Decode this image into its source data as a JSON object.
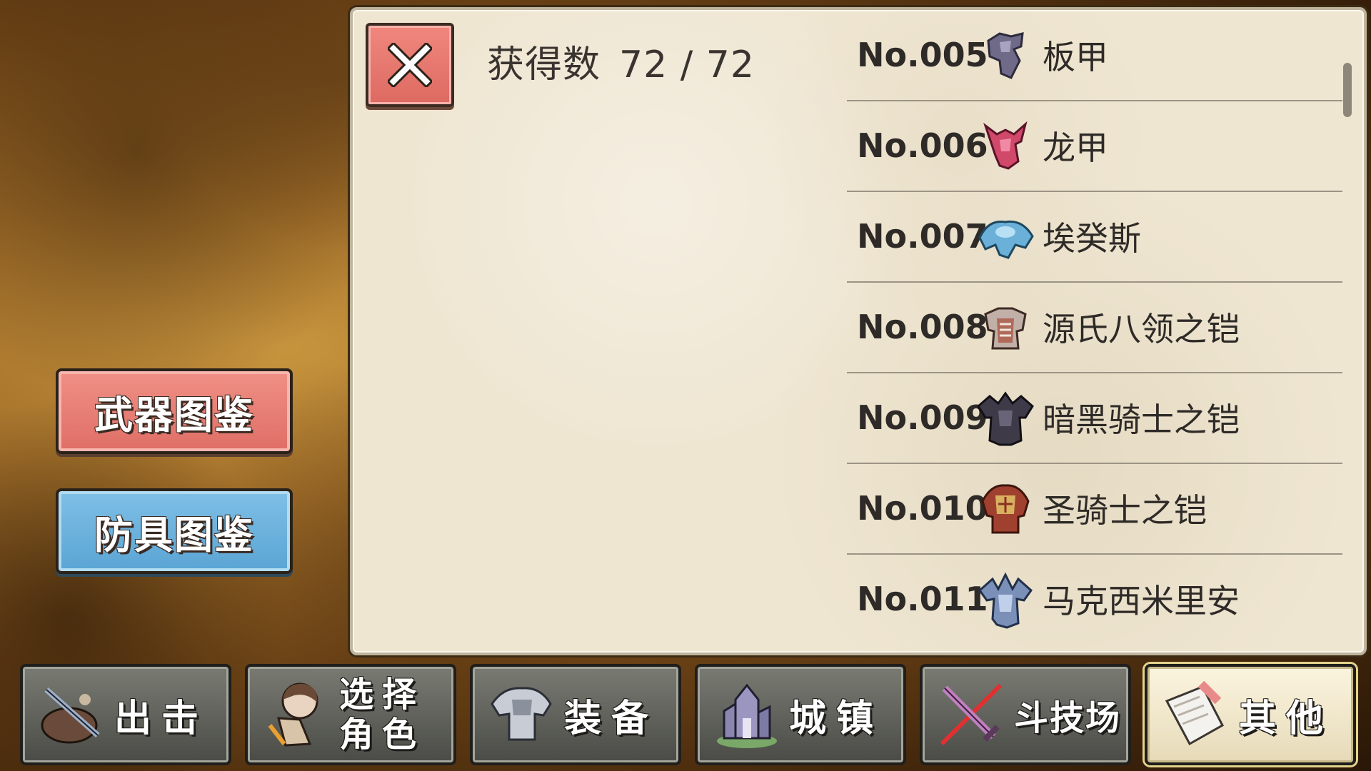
{
  "header": {
    "collected_label": "获得数",
    "collected_value": "72 / 72"
  },
  "close_button": {
    "icon": "close-icon"
  },
  "categories": {
    "weapon_label": "武器图鉴",
    "armor_label": "防具图鉴"
  },
  "armor_list": [
    {
      "no": "No.005",
      "name": "板甲",
      "icon": "plate-armor-icon",
      "color": "#6e6a88"
    },
    {
      "no": "No.006",
      "name": "龙甲",
      "icon": "dragon-armor-icon",
      "color": "#d0486a"
    },
    {
      "no": "No.007",
      "name": "埃癸斯",
      "icon": "aegis-icon",
      "color": "#6ab0d8"
    },
    {
      "no": "No.008",
      "name": "源氏八领之铠",
      "icon": "genji-armor-icon",
      "color": "#b06a5a"
    },
    {
      "no": "No.009",
      "name": "暗黑骑士之铠",
      "icon": "dark-knight-armor-icon",
      "color": "#3e3a48"
    },
    {
      "no": "No.010",
      "name": "圣骑士之铠",
      "icon": "paladin-armor-icon",
      "color": "#a0402e"
    },
    {
      "no": "No.011",
      "name": "马克西米里安",
      "icon": "maximilian-armor-icon",
      "color": "#7a90b8"
    }
  ],
  "nav": [
    {
      "label": "出击",
      "icon": "sortie-icon"
    },
    {
      "label": "选择角色",
      "icon": "character-select-icon"
    },
    {
      "label": "装备",
      "icon": "equipment-icon"
    },
    {
      "label": "城镇",
      "icon": "town-icon"
    },
    {
      "label": "斗技场",
      "icon": "arena-icon"
    },
    {
      "label": "其他",
      "icon": "other-icon"
    }
  ]
}
